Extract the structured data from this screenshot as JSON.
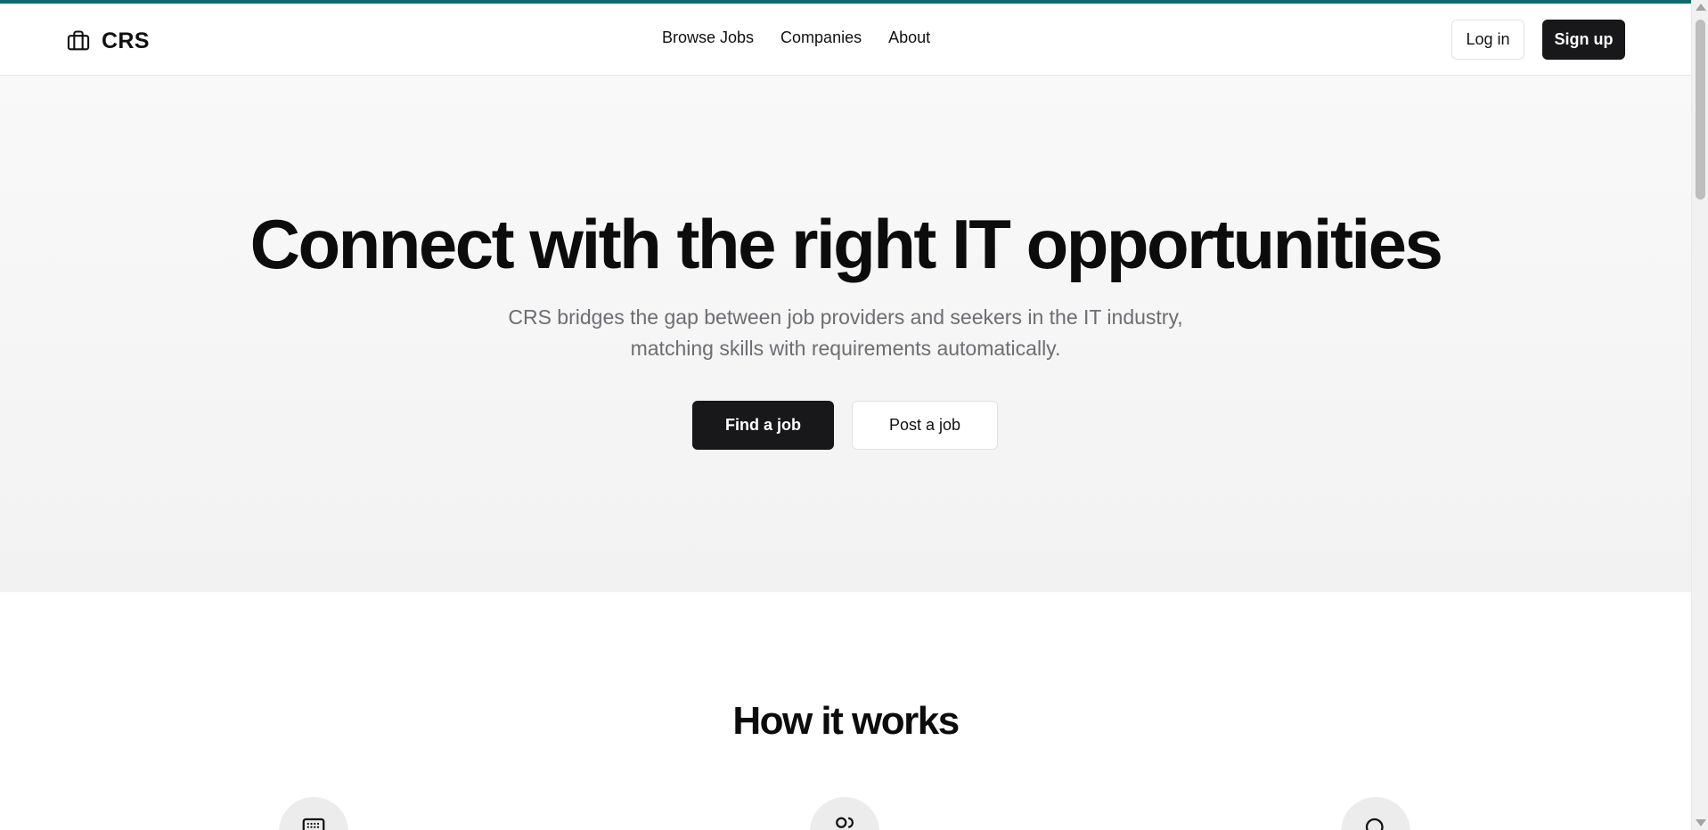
{
  "brand": {
    "name": "CRS",
    "icon": "briefcase-icon"
  },
  "nav": {
    "items": [
      {
        "label": "Browse Jobs"
      },
      {
        "label": "Companies"
      },
      {
        "label": "About"
      }
    ]
  },
  "auth": {
    "login_label": "Log in",
    "signup_label": "Sign up"
  },
  "hero": {
    "title": "Connect with the right IT opportunities",
    "subtitle_line1": "CRS bridges the gap between job providers and seekers in the IT industry,",
    "subtitle_line2": "matching skills with requirements automatically.",
    "primary_cta": "Find a job",
    "secondary_cta": "Post a job"
  },
  "how_it_works": {
    "title": "How it works",
    "steps": [
      {
        "icon": "keyboard-icon"
      },
      {
        "icon": "users-icon"
      },
      {
        "icon": "search-icon"
      }
    ]
  },
  "colors": {
    "accent_strip": "#0f6b6b",
    "primary_button": "#18181a",
    "hero_background": "#f5f5f5",
    "muted_text": "#6d6d73"
  }
}
